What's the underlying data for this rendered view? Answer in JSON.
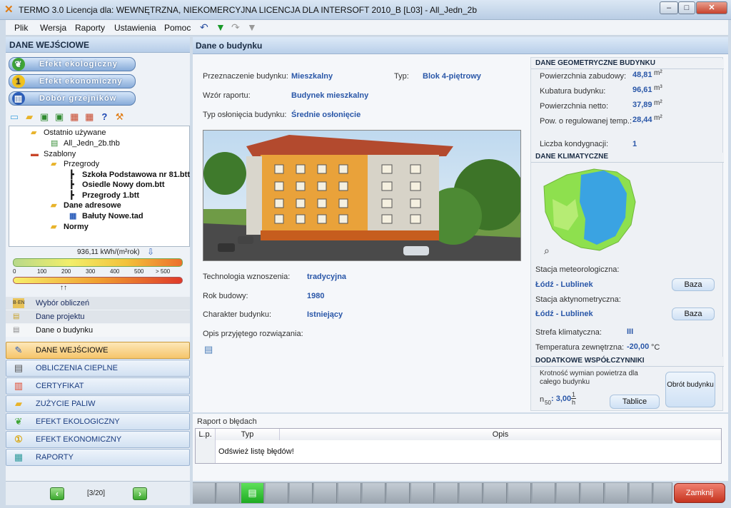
{
  "window": {
    "title": "TERMO 3.0 Licencja dla: WEWNĘTRZNA, NIEKOMERCYJNA LICENCJA DLA INTERSOFT 2010_B [L03] - All_Jedn_2b",
    "btn_min": "–",
    "btn_max": "□",
    "btn_close": "✕"
  },
  "menu": [
    "Plik",
    "Wersja",
    "Raporty",
    "Ustawienia",
    "Pomoc"
  ],
  "left": {
    "section_title": "DANE WEJŚCIOWE",
    "pills": [
      "Efekt ekologiczny",
      "Efekt ekonomiczny",
      "Dobór grzejników"
    ],
    "tree": {
      "recent": "Ostatnio używane",
      "recent_file": "All_Jedn_2b.thb",
      "templates": "Szablony",
      "partitions": "Przegrody",
      "file1": "Szkoła Podstawowa nr 81.btt",
      "file2": "Osiedle Nowy dom.btt",
      "file3": "Przegrody 1.btt",
      "address_data": "Dane adresowe",
      "address_file": "Bałuty Nowe.tad",
      "norms": "Normy"
    },
    "energy": {
      "value": "936,11 kWh/(m²rok)",
      "ticks": [
        "100",
        "200",
        "300",
        "400",
        "500",
        "> 500"
      ],
      "tick_zero": "0",
      "arrows": "↑↑"
    },
    "subnav": [
      "Wybór obliczeń",
      "Dane projektu",
      "Dane o budynku"
    ],
    "subnav_icons": [
      "B·EN",
      "▤",
      "▤"
    ],
    "mainnav": [
      "DANE WEJŚCIOWE",
      "OBLICZENIA CIEPLNE",
      "CERTYFIKAT",
      "ZUŻYCIE PALIW",
      "EFEKT EKOLOGICZNY",
      "EFEKT EKONOMICZNY",
      "RAPORTY"
    ],
    "pager": "[3/20]",
    "pager_prev": "‹",
    "pager_next": "›"
  },
  "main": {
    "title": "Dane o budynku",
    "przeznaczenie_label": "Przeznaczenie budynku:",
    "przeznaczenie_val": "Mieszkalny",
    "typ_label": "Typ:",
    "typ_val": "Blok 4-piętrowy",
    "wzor_label": "Wzór raportu:",
    "wzor_val": "Budynek mieszkalny",
    "oslon_label": "Typ osłonięcia budynku:",
    "oslon_val": "Średnie osłonięcie",
    "tech_label": "Technologia wznoszenia:",
    "tech_val": "tradycyjna",
    "rok_label": "Rok budowy:",
    "rok_val": "1980",
    "char_label": "Charakter budynku:",
    "char_val": "Istniejący",
    "opis_label": "Opis przyjętego rozwiązania:"
  },
  "geom": {
    "title": "DANE GEOMETRYCZNE BUDYNKU",
    "rows": [
      {
        "label": "Powierzchnia zabudowy:",
        "value": "48,81",
        "unit": "m²"
      },
      {
        "label": "Kubatura budynku:",
        "value": "96,61",
        "unit": "m³"
      },
      {
        "label": "Powierzchnia netto:",
        "value": "37,89",
        "unit": "m²"
      },
      {
        "label": "Pow. o regulowanej temp.:",
        "value": "28,44",
        "unit": "m²"
      }
    ],
    "kond_label": "Liczba kondygnacji:",
    "kond_val": "1"
  },
  "klimat": {
    "title": "DANE KLIMATYCZNE",
    "stacja_met_label": "Stacja meteorologiczna:",
    "stacja_met_val": "Łódź - Lublinek",
    "stacja_akt_label": "Stacja aktynometryczna:",
    "stacja_akt_val": "Łódź - Lublinek",
    "baza": "Baza",
    "strefa_label": "Strefa klimatyczna:",
    "strefa_val": "III",
    "temp_label": "Temperatura zewnętrzna:",
    "temp_val": "-20,00",
    "temp_unit": "°C"
  },
  "wspol": {
    "title": "DODATKOWE WSPÓŁCZYNNIKI",
    "krotnosc": "Krotność wymian powietrza dla całego budynku",
    "n50_label": "n",
    "n50_sub": "50",
    "n50_val": ": 3,00",
    "n50_unit_num": "1",
    "n50_unit_den": "h",
    "tablice": "Tablice",
    "obrot": "Obrót budynku"
  },
  "errors": {
    "title": "Raport o błędach",
    "col_lp": "L.p.",
    "col_typ": "Typ",
    "col_opis": "Opis",
    "refresh": "Odśwież listę błędów!"
  },
  "bottom": {
    "close": "Zamknij"
  }
}
